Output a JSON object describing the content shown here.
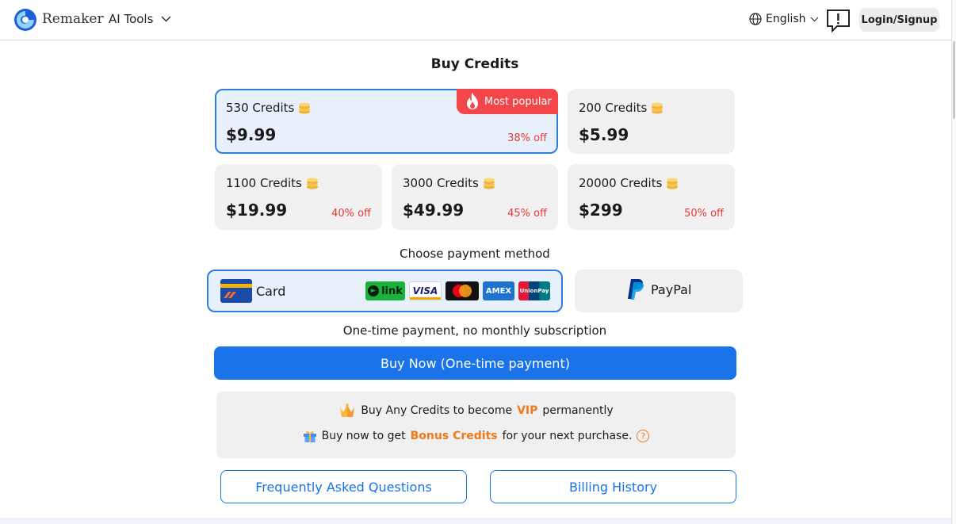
{
  "header": {
    "brand": "Remaker",
    "tools_label": "AI Tools",
    "language": "English",
    "login_label": "Login/Signup"
  },
  "page_title": "Buy Credits",
  "plans": [
    {
      "credits": "530 Credits",
      "price": "$9.99",
      "discount": "38% off",
      "badge": "Most popular",
      "selected": true
    },
    {
      "credits": "200 Credits",
      "price": "$5.99",
      "discount": "",
      "selected": false
    },
    {
      "credits": "1100 Credits",
      "price": "$19.99",
      "discount": "40% off",
      "selected": false
    },
    {
      "credits": "3000 Credits",
      "price": "$49.99",
      "discount": "45% off",
      "selected": false
    },
    {
      "credits": "20000 Credits",
      "price": "$299",
      "discount": "50% off",
      "selected": false
    }
  ],
  "payment": {
    "title": "Choose payment method",
    "card_label": "Card",
    "card_brands": [
      "link",
      "VISA",
      "mastercard",
      "AMEX",
      "UnionPay"
    ],
    "paypal_label": "PayPal",
    "selected": "card"
  },
  "onetime_note": "One-time payment, no monthly subscription",
  "buy_button": "Buy Now (One-time payment)",
  "vip": {
    "line1_prefix": "Buy Any Credits to become",
    "line1_highlight": "VIP",
    "line1_suffix": "permanently",
    "line2_prefix": "Buy now to get",
    "line2_highlight": "Bonus Credits",
    "line2_suffix": "for your next purchase.",
    "help_glyph": "?"
  },
  "faq_button": "Frequently Asked Questions",
  "billing_button": "Billing History",
  "colors": {
    "accent": "#1a73e8",
    "selected_bg": "#e8f0fc",
    "discount": "#e53935",
    "highlight": "#f07a18",
    "badge": "#f2464a"
  }
}
